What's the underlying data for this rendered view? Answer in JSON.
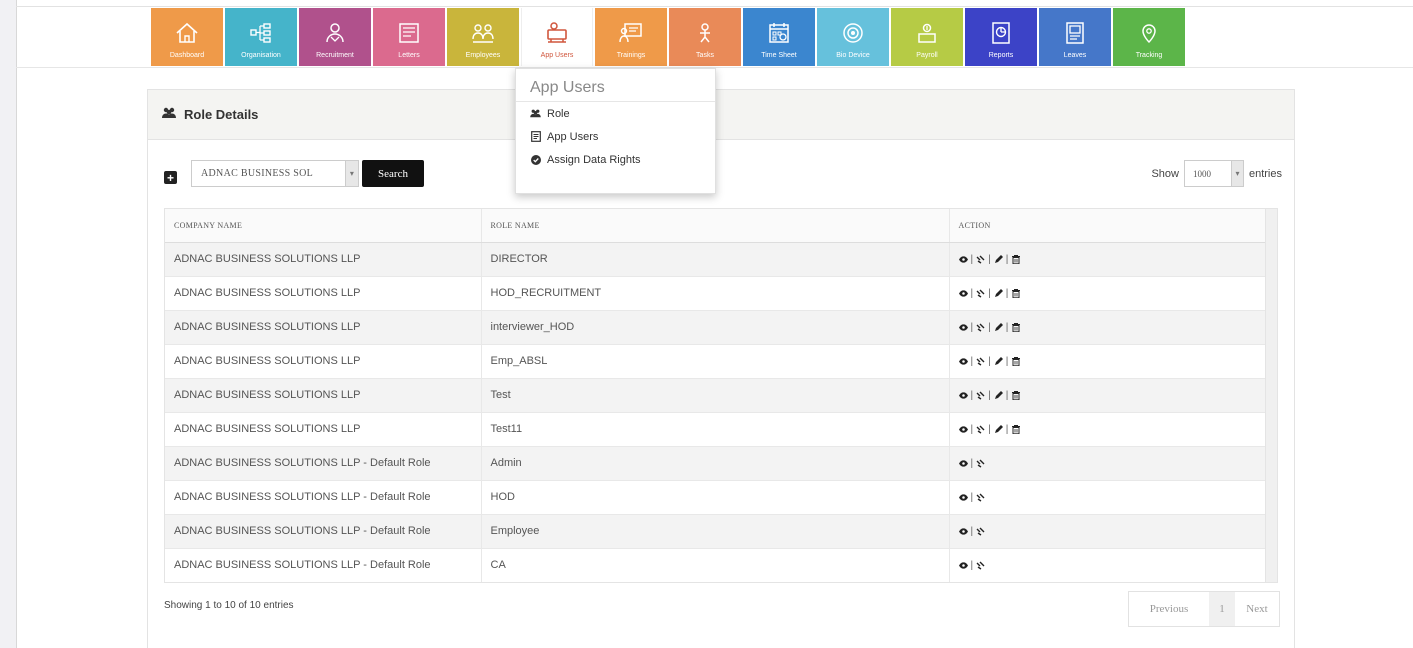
{
  "nav": {
    "tiles": [
      {
        "label": "Dashboard",
        "color": "#ef9a49",
        "icon": "home-icon"
      },
      {
        "label": "Organisation",
        "color": "#45b4ca",
        "icon": "org-chart-icon"
      },
      {
        "label": "Recruitment",
        "color": "#b0518c",
        "icon": "recruitment-icon"
      },
      {
        "label": "Letters",
        "color": "#db6a8e",
        "icon": "letters-icon"
      },
      {
        "label": "Employees",
        "color": "#c9b53b",
        "icon": "employees-icon"
      },
      {
        "label": "App Users",
        "color": "#ffffff",
        "icon": "app-users-icon"
      },
      {
        "label": "Trainings",
        "color": "#ef9a49",
        "icon": "trainings-icon"
      },
      {
        "label": "Tasks",
        "color": "#e98a58",
        "icon": "tasks-icon"
      },
      {
        "label": "Time Sheet",
        "color": "#3b86cf",
        "icon": "timesheet-icon"
      },
      {
        "label": "Bio Device",
        "color": "#66c1dc",
        "icon": "bio-device-icon"
      },
      {
        "label": "Payroll",
        "color": "#b6cb45",
        "icon": "payroll-icon"
      },
      {
        "label": "Reports",
        "color": "#3c43c7",
        "icon": "reports-icon"
      },
      {
        "label": "Leaves",
        "color": "#4577c9",
        "icon": "leaves-icon"
      },
      {
        "label": "Tracking",
        "color": "#5cb549",
        "icon": "tracking-icon"
      }
    ]
  },
  "dropdown": {
    "title": "App Users",
    "items": [
      {
        "label": "Role",
        "icon": "users-icon"
      },
      {
        "label": "App Users",
        "icon": "document-icon"
      },
      {
        "label": "Assign Data Rights",
        "icon": "check-circle-icon"
      }
    ]
  },
  "panel": {
    "title": "Role Details"
  },
  "toolbar": {
    "company_value": "ADNAC BUSINESS SOL",
    "search_label": "Search",
    "show_label": "Show",
    "entries_value": "1000",
    "entries_label": "entries"
  },
  "table": {
    "headers": [
      "COMPANY NAME",
      "ROLE NAME",
      "ACTION"
    ],
    "rows": [
      {
        "company": "ADNAC BUSINESS SOLUTIONS LLP",
        "role": "DIRECTOR",
        "full_actions": true
      },
      {
        "company": "ADNAC BUSINESS SOLUTIONS LLP",
        "role": "HOD_RECRUITMENT",
        "full_actions": true
      },
      {
        "company": "ADNAC BUSINESS SOLUTIONS LLP",
        "role": "interviewer_HOD",
        "full_actions": true
      },
      {
        "company": "ADNAC BUSINESS SOLUTIONS LLP",
        "role": "Emp_ABSL",
        "full_actions": true
      },
      {
        "company": "ADNAC BUSINESS SOLUTIONS LLP",
        "role": "Test",
        "full_actions": true
      },
      {
        "company": "ADNAC BUSINESS SOLUTIONS LLP",
        "role": "Test11",
        "full_actions": true
      },
      {
        "company": "ADNAC BUSINESS SOLUTIONS LLP - Default Role",
        "role": "Admin",
        "full_actions": false
      },
      {
        "company": "ADNAC BUSINESS SOLUTIONS LLP - Default Role",
        "role": "HOD",
        "full_actions": false
      },
      {
        "company": "ADNAC BUSINESS SOLUTIONS LLP - Default Role",
        "role": "Employee",
        "full_actions": false
      },
      {
        "company": "ADNAC BUSINESS SOLUTIONS LLP - Default Role",
        "role": "CA",
        "full_actions": false
      }
    ]
  },
  "footer": {
    "info": "Showing 1 to 10 of 10 entries",
    "prev_label": "Previous",
    "page": "1",
    "next_label": "Next"
  }
}
